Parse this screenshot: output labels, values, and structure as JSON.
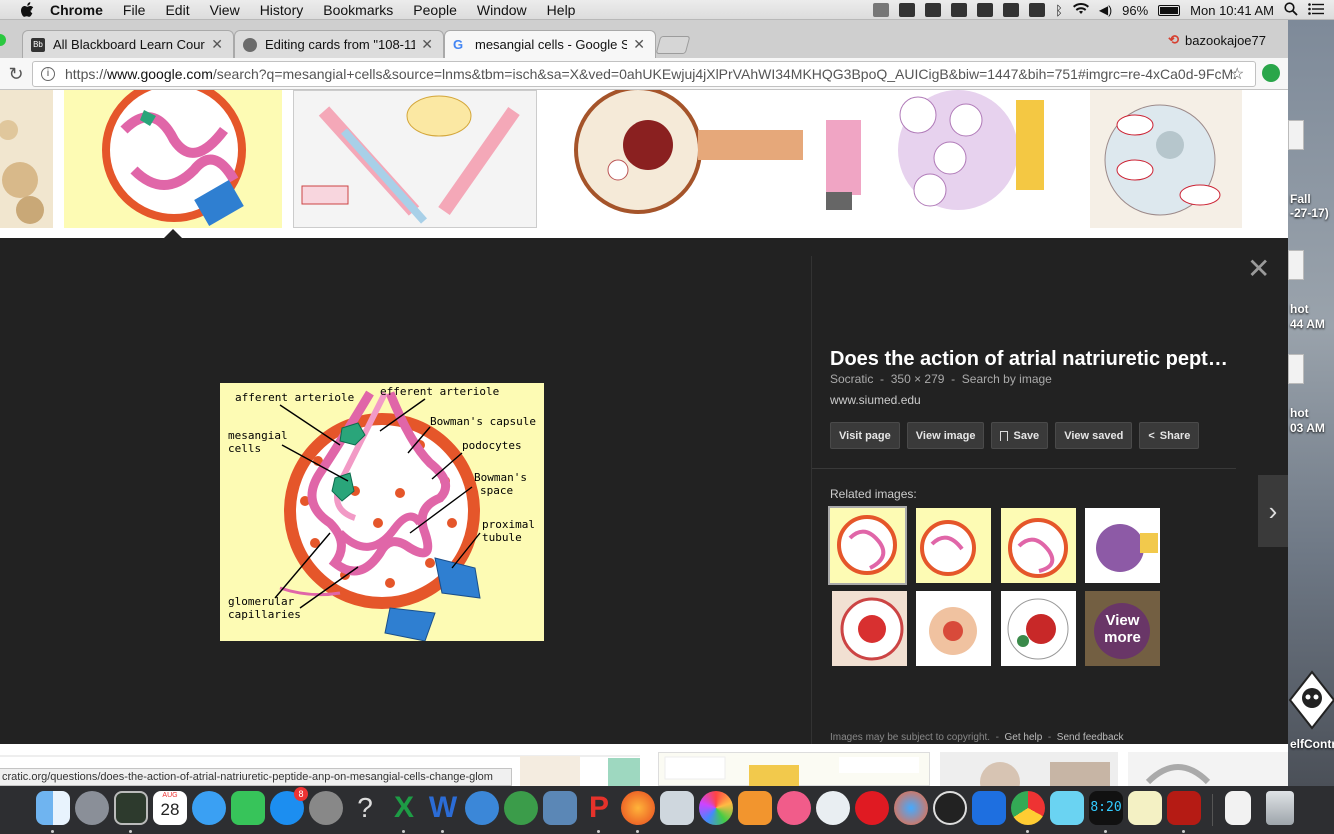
{
  "menubar": {
    "app": "Chrome",
    "menus": [
      "File",
      "Edit",
      "View",
      "History",
      "Bookmarks",
      "People",
      "Window",
      "Help"
    ],
    "battery": "96%",
    "clock": "Mon 10:41 AM"
  },
  "tabs": [
    {
      "title": "All Blackboard Learn Courses -",
      "favicon_color": "#333333"
    },
    {
      "title": "Editing cards from \"108-117\"",
      "favicon_color": "#6b6b6b"
    },
    {
      "title": "mesangial cells - Google Searc",
      "favicon_color": "#4285f4"
    }
  ],
  "profile": "bazookajoe77",
  "address": {
    "scheme": "https://",
    "domain": "www.google.com",
    "path": "/search?q=mesangial+cells&source=lnms&tbm=isch&sa=X&ved=0ahUKEwjuj4jXlPrVAhWI34MKHQG3BpoQ_AUICigB&biw=1447&bih=751#imgrc=re-4xCa0d-9FcM:"
  },
  "main_image": {
    "labels": {
      "afferent": "afferent arteriole",
      "efferent": "efferent arteriole",
      "mesangial": "mesangial\ncells",
      "capsule": "Bowman's capsule",
      "podocytes": "podocytes",
      "space": "Bowman's\nspace",
      "proximal": "proximal\ntubule",
      "glomerular": "glomerular\ncapillaries"
    }
  },
  "info": {
    "title": "Does the action of atrial natriuretic pepti...",
    "source": "Socratic",
    "dims": "350 × 279",
    "search_by_image": "Search by image",
    "url": "www.siumed.edu",
    "buttons": {
      "visit": "Visit page",
      "view_image": "View image",
      "save": "Save",
      "view_saved": "View saved",
      "share": "Share"
    },
    "related_label": "Related images:",
    "view_more": "View\nmore",
    "footer_copyright": "Images may be subject to copyright.",
    "footer_help": "Get help",
    "footer_feedback": "Send feedback"
  },
  "status_url": "cratic.org/questions/does-the-action-of-atrial-natriuretic-peptide-anp-on-mesangial-cells-change-glom",
  "desktop": {
    "labels": [
      "Fall",
      "-27-17)",
      "hot",
      "44 AM",
      "hot",
      "03 AM",
      "elfContr"
    ]
  },
  "dock": {
    "calendar_month": "AUG",
    "calendar_day": "28",
    "badge": "8",
    "clock": "8:20"
  }
}
